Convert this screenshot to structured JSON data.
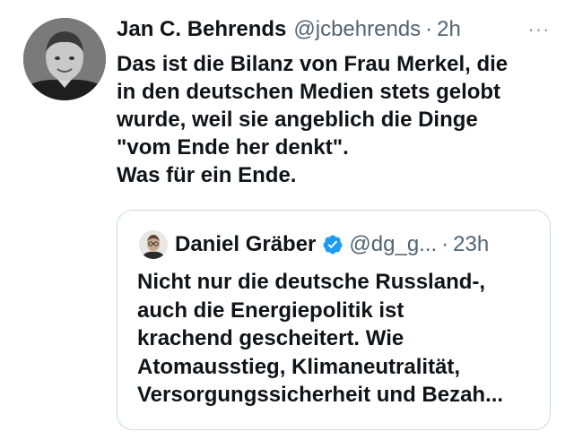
{
  "tweet": {
    "author_name": "Jan C. Behrends",
    "author_handle": "@jcbehrends",
    "separator": "·",
    "timestamp": "2h",
    "more_icon": "···",
    "text_lines": [
      "Das ist die Bilanz von Frau Merkel, die",
      "in den deutschen Medien stets gelobt",
      "wurde, weil sie angeblich die Dinge",
      "\"vom Ende her denkt\".",
      "Was für ein Ende."
    ]
  },
  "quoted_tweet": {
    "author_name": "Daniel Gräber",
    "verified_icon": "verified-badge-icon",
    "author_handle": "@dg_g...",
    "separator": "·",
    "timestamp": "23h",
    "text_lines": [
      "Nicht nur die deutsche Russland-,",
      "auch die Energiepolitik ist",
      "krachend gescheitert. Wie",
      "Atomausstieg, Klimaneutralität,",
      "Versorgungssicherheit und Bezah..."
    ]
  },
  "colors": {
    "text": "#0f1419",
    "secondary": "#536471",
    "border": "#cfd9de",
    "verified": "#1d9bf0"
  }
}
